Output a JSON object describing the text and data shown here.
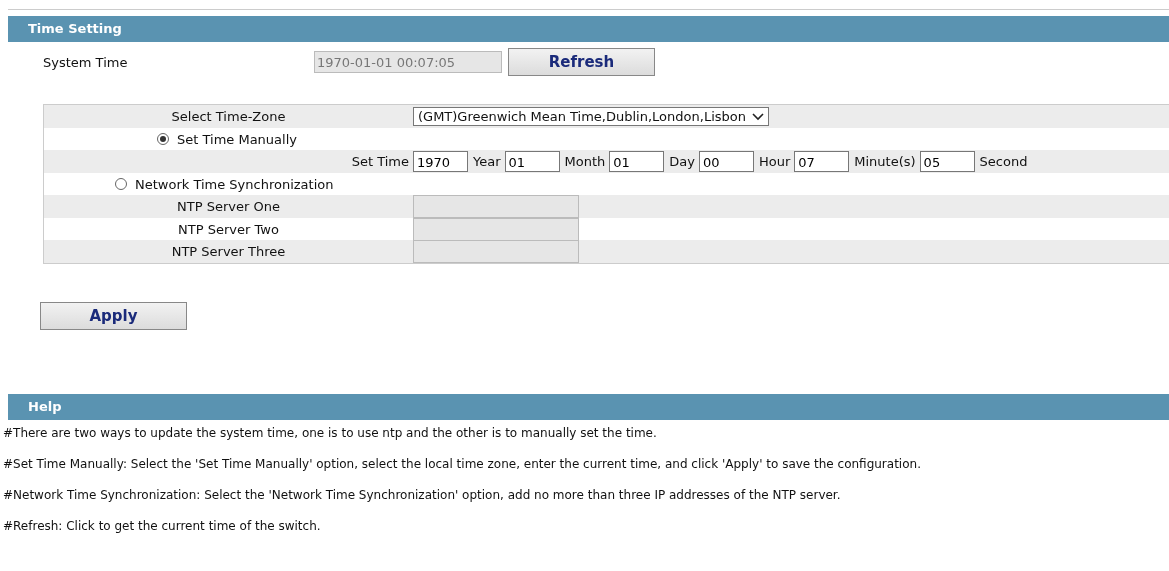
{
  "sections": [
    {
      "title": "Time Setting"
    }
  ],
  "system_time": {
    "label": "System Time",
    "value": "1970-01-01 00:07:05",
    "disabled": true,
    "button": "Refresh"
  },
  "timezone": {
    "label": "Select Time-Zone",
    "value": "(GMT)Greenwich Mean Time,Dublin,London,Lisbon"
  },
  "modes": [
    {
      "label": "Set Time Manually",
      "selected": true
    },
    {
      "label": "Network Time Synchronization",
      "selected": false
    }
  ],
  "set_time": {
    "label": "Set Time",
    "fields": [
      {
        "value": "1970",
        "unit": "Year"
      },
      {
        "value": "01",
        "unit": "Month"
      },
      {
        "value": "01",
        "unit": "Day"
      },
      {
        "value": "00",
        "unit": "Hour"
      },
      {
        "value": "07",
        "unit": "Minute(s)"
      },
      {
        "value": "05",
        "unit": "Second"
      }
    ]
  },
  "ntp_servers": [
    {
      "label": "NTP Server One",
      "disabled": true
    },
    {
      "label": "NTP Server Two",
      "disabled": true
    },
    {
      "label": "NTP Server Three",
      "disabled": true
    }
  ],
  "apply_button": "Apply",
  "help": {
    "title": "Help",
    "lines": [
      "#There are two ways to update the system time, one is to use ntp and the other is to manually set the time.",
      "#Set Time Manually: Select the 'Set Time Manually' option, select the local time zone, enter the current time, and click 'Apply' to save the configuration.",
      "#Network Time Synchronization: Select the 'Network Time Synchronization' option, add no more than three IP addresses of the NTP server.",
      "#Refresh: Click to get the current time of the switch."
    ]
  }
}
